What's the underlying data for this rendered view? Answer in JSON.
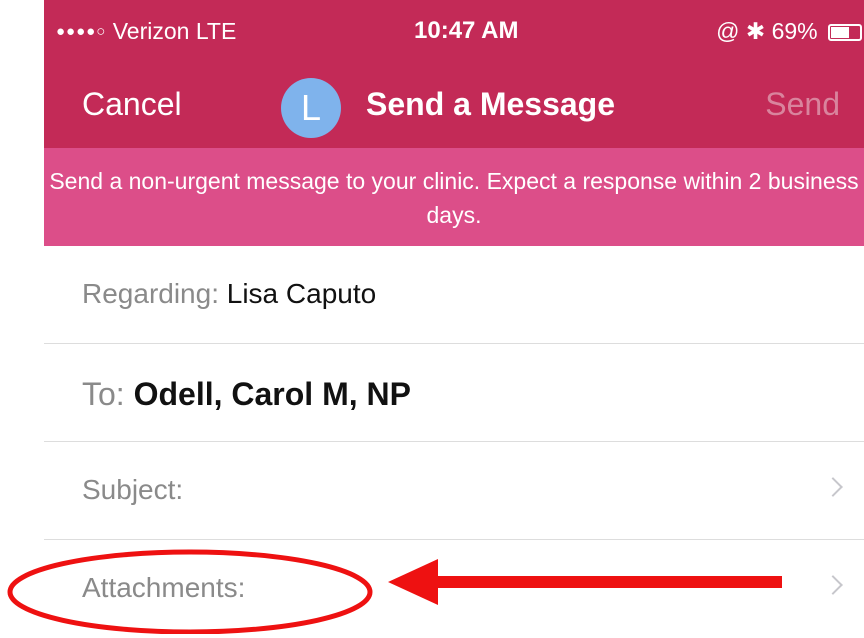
{
  "status_bar": {
    "signal": "●●●●○",
    "carrier": "Verizon",
    "network": "LTE",
    "time": "10:47 AM",
    "icons": "@ ✱",
    "battery": "69%",
    "battery_level": 0.69
  },
  "nav": {
    "cancel": "Cancel",
    "avatar_initial": "L",
    "title": "Send a Message",
    "send": "Send"
  },
  "banner": {
    "text": "Send a non-urgent message to your clinic. Expect a response within 2 business days."
  },
  "form": {
    "regarding_label": "Regarding:",
    "regarding_value": "Lisa Caputo",
    "to_label": "To:",
    "to_value": "Odell, Carol M, NP",
    "subject_label": "Subject:",
    "attachments_label": "Attachments:"
  },
  "colors": {
    "header": "#c32a57",
    "banner": "#dc4e89",
    "avatar": "#7fb3ec",
    "annotation": "#ee1111"
  }
}
